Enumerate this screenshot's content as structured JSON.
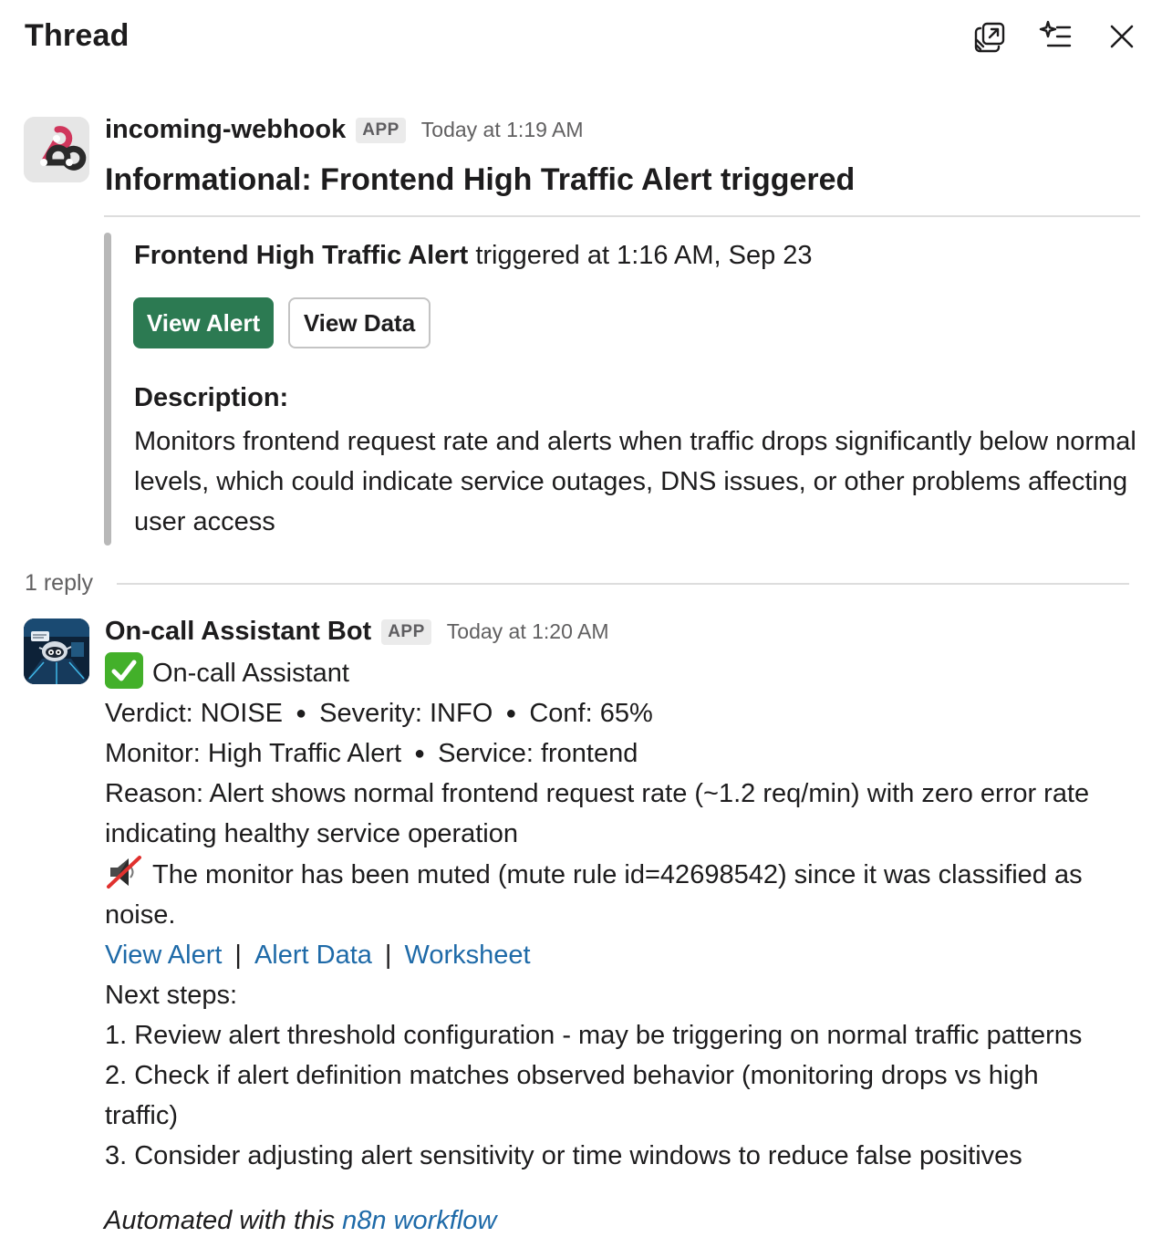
{
  "header": {
    "title": "Thread",
    "icons": [
      "open-in-window-icon",
      "ai-summary-icon",
      "close-icon"
    ]
  },
  "message1": {
    "sender": "incoming-webhook",
    "badge": "APP",
    "timestamp": "Today at 1:19 AM",
    "headline": "Informational: Frontend High Traffic Alert triggered",
    "attachment": {
      "alert_name": "Frontend High Traffic Alert",
      "triggered_text": "triggered at 1:16 AM, Sep 23",
      "primary_button": "View Alert",
      "secondary_button": "View Data",
      "description_label": "Description:",
      "description": "Monitors frontend request rate and alerts when traffic drops significantly below normal levels, which could indicate service outages, DNS issues, or other problems affecting user access",
      "bar_color": "#b8b8b8"
    }
  },
  "replies": {
    "count_label": "1 reply"
  },
  "message2": {
    "sender": "On-call Assistant Bot",
    "badge": "APP",
    "timestamp": "Today at 1:20 AM",
    "title": "On-call Assistant",
    "verdict": "Verdict: NOISE",
    "severity": "Severity: INFO",
    "confidence": "Conf: 65%",
    "monitor": "Monitor: High Traffic Alert",
    "service": "Service: frontend",
    "reason_line1": "Reason: Alert shows normal frontend request rate (~1.2 req/min) with zero error rate",
    "reason_line2": "indicating healthy service operation",
    "muted_line1": "The monitor has been muted (mute rule id=42698542) since it was classified as",
    "muted_line2": "noise.",
    "links": [
      "View Alert",
      "Alert Data",
      "Worksheet"
    ],
    "link_separator": "|",
    "next_steps_label": "Next steps:",
    "step1": "1. Review alert threshold configuration - may be triggering on normal traffic patterns",
    "step2_line1": "2. Check if alert definition matches observed behavior (monitoring drops vs high",
    "step2_line2": "traffic)",
    "step3": "3. Consider adjusting alert sensitivity or time windows to reduce false positives",
    "footer_prefix": "Automated with this",
    "footer_link": "n8n workflow"
  },
  "colors": {
    "primary_button": "#2c7a52",
    "link": "#1e6aa8",
    "check": "#43b02a",
    "webhook_logo": "#d0365c"
  }
}
